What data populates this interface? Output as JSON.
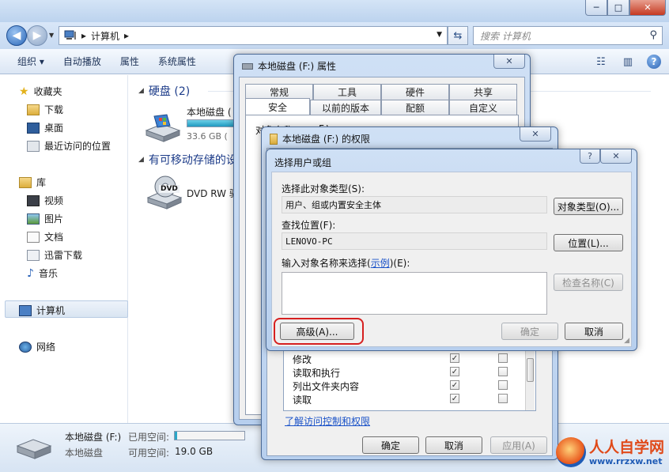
{
  "explorer": {
    "title_buttons": {
      "minimize": "─",
      "maximize": "□",
      "close": "✕"
    },
    "address": {
      "root_icon": "computer-icon",
      "path": "计算机",
      "separator": "▸"
    },
    "search_placeholder": "搜索 计算机",
    "toolbar": {
      "organize": "组织 ▾",
      "autoplay": "自动播放",
      "properties": "属性",
      "system_properties": "系统属性"
    },
    "sidebar": {
      "favorites": "收藏夹",
      "favorites_items": [
        "下载",
        "桌面",
        "最近访问的位置"
      ],
      "libraries": "库",
      "library_items": [
        "视频",
        "图片",
        "文档",
        "迅雷下载",
        "音乐"
      ],
      "computer": "计算机",
      "network": "网络"
    },
    "content": {
      "hdd_group": "硬盘 (2)",
      "drive_f_name": "本地磁盘 (",
      "drive_f_size": "33.6 GB (",
      "removable_group": "有可移动存储的设",
      "dvd_name": "DVD RW 驱",
      "dvd_badge": "DVD"
    },
    "status": {
      "drive_name": "本地磁盘 (F:)",
      "used_label": "已用空间:",
      "type": "本地磁盘",
      "free_label": "可用空间:",
      "free_value": "19.0 GB"
    }
  },
  "properties_dialog": {
    "title": "本地磁盘 (F:) 属性",
    "tabs_row1": [
      "常规",
      "工具",
      "硬件",
      "共享"
    ],
    "tabs_row2": [
      "安全",
      "以前的版本",
      "配额",
      "自定义"
    ],
    "partial_label": "对象名称:",
    "partial_value": "F:\\"
  },
  "permissions_dialog": {
    "title": "本地磁盘 (F:) 的权限",
    "perm_rows": [
      {
        "name": "修改",
        "allow": "✓",
        "deny": ""
      },
      {
        "name": "读取和执行",
        "allow": "✓",
        "deny": ""
      },
      {
        "name": "列出文件夹内容",
        "allow": "✓",
        "deny": ""
      },
      {
        "name": "读取",
        "allow": "✓",
        "deny": ""
      }
    ],
    "link": "了解访问控制和权限",
    "ok": "确定",
    "cancel": "取消",
    "apply": "应用(A)"
  },
  "select_dialog": {
    "title": "选择用户或组",
    "help": "?",
    "close": "✕",
    "object_type_label": "选择此对象类型(S):",
    "object_type_value": "用户、组或内置安全主体",
    "object_type_btn": "对象类型(O)...",
    "location_label": "查找位置(F):",
    "location_value": "LENOVO-PC",
    "location_btn": "位置(L)...",
    "names_label_pre": "输入对象名称来选择(",
    "names_label_link": "示例",
    "names_label_post": ")(E):",
    "check_names_btn": "检查名称(C)",
    "advanced_btn": "高级(A)...",
    "ok_btn": "确定",
    "cancel_btn": "取消"
  },
  "watermark": {
    "brand": "人人自学网",
    "url": "www.rrzxw.net"
  },
  "colors": {
    "link": "#1a52c8",
    "highlight_red": "#d62020",
    "progress": "#2aa6c8",
    "dialog_frame": "#b7cfee"
  }
}
